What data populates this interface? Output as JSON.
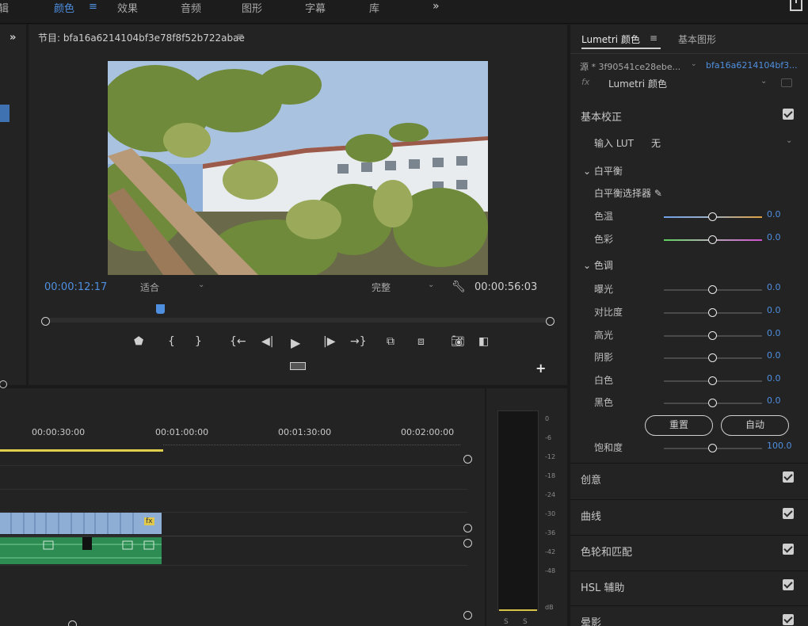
{
  "topbar": {
    "workspaces": [
      "辑",
      "颜色",
      "效果",
      "音频",
      "图形",
      "字幕",
      "库"
    ],
    "active": "颜色",
    "menu_glyph": "≡",
    "overflow": "»"
  },
  "left_panel": {
    "chevron": "»"
  },
  "program": {
    "title": "节目: bfa16a6214104bf3e78f8f52b722abae",
    "menu_glyph": "≡",
    "timecode_current": "00:00:12:17",
    "fit": "适合",
    "quality": "完整",
    "timecode_duration": "00:00:56:03",
    "playhead_fraction": 0.23,
    "transport_icons": [
      "marker-icon",
      "mark-in-icon",
      "mark-out-icon",
      "go-to-in-icon",
      "step-back-icon",
      "play-icon",
      "step-forward-icon",
      "go-to-out-icon",
      "lift-icon",
      "extract-icon",
      "export-frame-icon",
      "compare-view-icon"
    ],
    "add_button": "+"
  },
  "timeline": {
    "times": [
      "00:00:30:00",
      "00:01:00:00",
      "00:01:30:00",
      "00:02:00:00"
    ],
    "clip_badge": "fx"
  },
  "audio_meter": {
    "db_labels": [
      "0",
      "-6",
      "-12",
      "-18",
      "-24",
      "-30",
      "-36",
      "-42",
      "-48",
      "dB"
    ],
    "channels": [
      "S",
      "S"
    ]
  },
  "lumetri": {
    "tab_active": "Lumetri 颜色",
    "tab_menu": "≡",
    "tab_second": "基本图形",
    "source_left": "源 * 3f90541ce28ebe...",
    "source_right": "bfa16a6214104bf3...",
    "effect_prefix": "fx",
    "effect_name": "Lumetri 颜色",
    "basic_correction": "基本校正",
    "input_lut_label": "输入 LUT",
    "input_lut_value": "无",
    "white_balance": "白平衡",
    "wb_picker": "白平衡选择器",
    "tone": "色调",
    "wb_rows": [
      {
        "label": "色温",
        "value": "0.0",
        "level": 0.5
      },
      {
        "label": "色彩",
        "value": "0.0",
        "level": 0.5
      }
    ],
    "tone_rows": [
      {
        "label": "曝光",
        "value": "0.0",
        "level": 0.5
      },
      {
        "label": "对比度",
        "value": "0.0",
        "level": 0.5
      },
      {
        "label": "高光",
        "value": "0.0",
        "level": 0.5
      },
      {
        "label": "阴影",
        "value": "0.0",
        "level": 0.5
      },
      {
        "label": "白色",
        "value": "0.0",
        "level": 0.5
      },
      {
        "label": "黑色",
        "value": "0.0",
        "level": 0.5
      }
    ],
    "reset": "重置",
    "auto": "自动",
    "saturation": {
      "label": "饱和度",
      "value": "100.0",
      "level": 0.5
    },
    "sections": [
      "创意",
      "曲线",
      "色轮和匹配",
      "HSL 辅助",
      "晕影"
    ],
    "colors": {
      "accent": "#4f8fe0",
      "temp_cold": "#6fa0e8",
      "temp_warm": "#e0a040",
      "tint_green": "#5fd05f",
      "tint_magenta": "#d050d0"
    }
  }
}
